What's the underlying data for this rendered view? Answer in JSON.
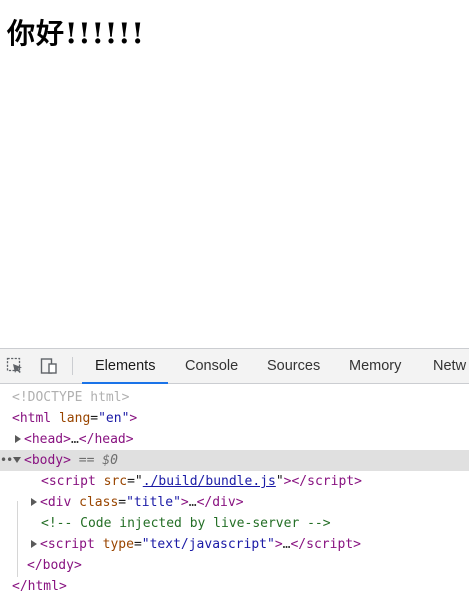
{
  "page": {
    "heading": "你好!!!!!!"
  },
  "devtools": {
    "toolbar": {
      "inspect_icon": "inspect-element-icon",
      "device_icon": "device-toolbar-icon",
      "tabs": [
        {
          "label": "Elements",
          "active": true
        },
        {
          "label": "Console",
          "active": false
        },
        {
          "label": "Sources",
          "active": false
        },
        {
          "label": "Memory",
          "active": false
        },
        {
          "label": "Netw",
          "active": false
        }
      ]
    },
    "accent_color": "#1a73e8",
    "dom": {
      "doctype": "<!DOCTYPE html>",
      "html_tag": "html",
      "html_attr": "lang",
      "html_attr_val": "\"en\"",
      "head_tag": "head",
      "body_tag": "body",
      "selected_marker": "== $0",
      "script_tag": "script",
      "script_src_attr": "src",
      "script_src_val": "./build/bundle.js",
      "div_tag": "div",
      "div_attr": "class",
      "div_attr_val": "\"title\"",
      "comment": "<!-- Code injected by live-server -->",
      "script2_attr": "type",
      "script2_attr_val": "\"text/javascript\"",
      "ellipsis": "…"
    }
  }
}
